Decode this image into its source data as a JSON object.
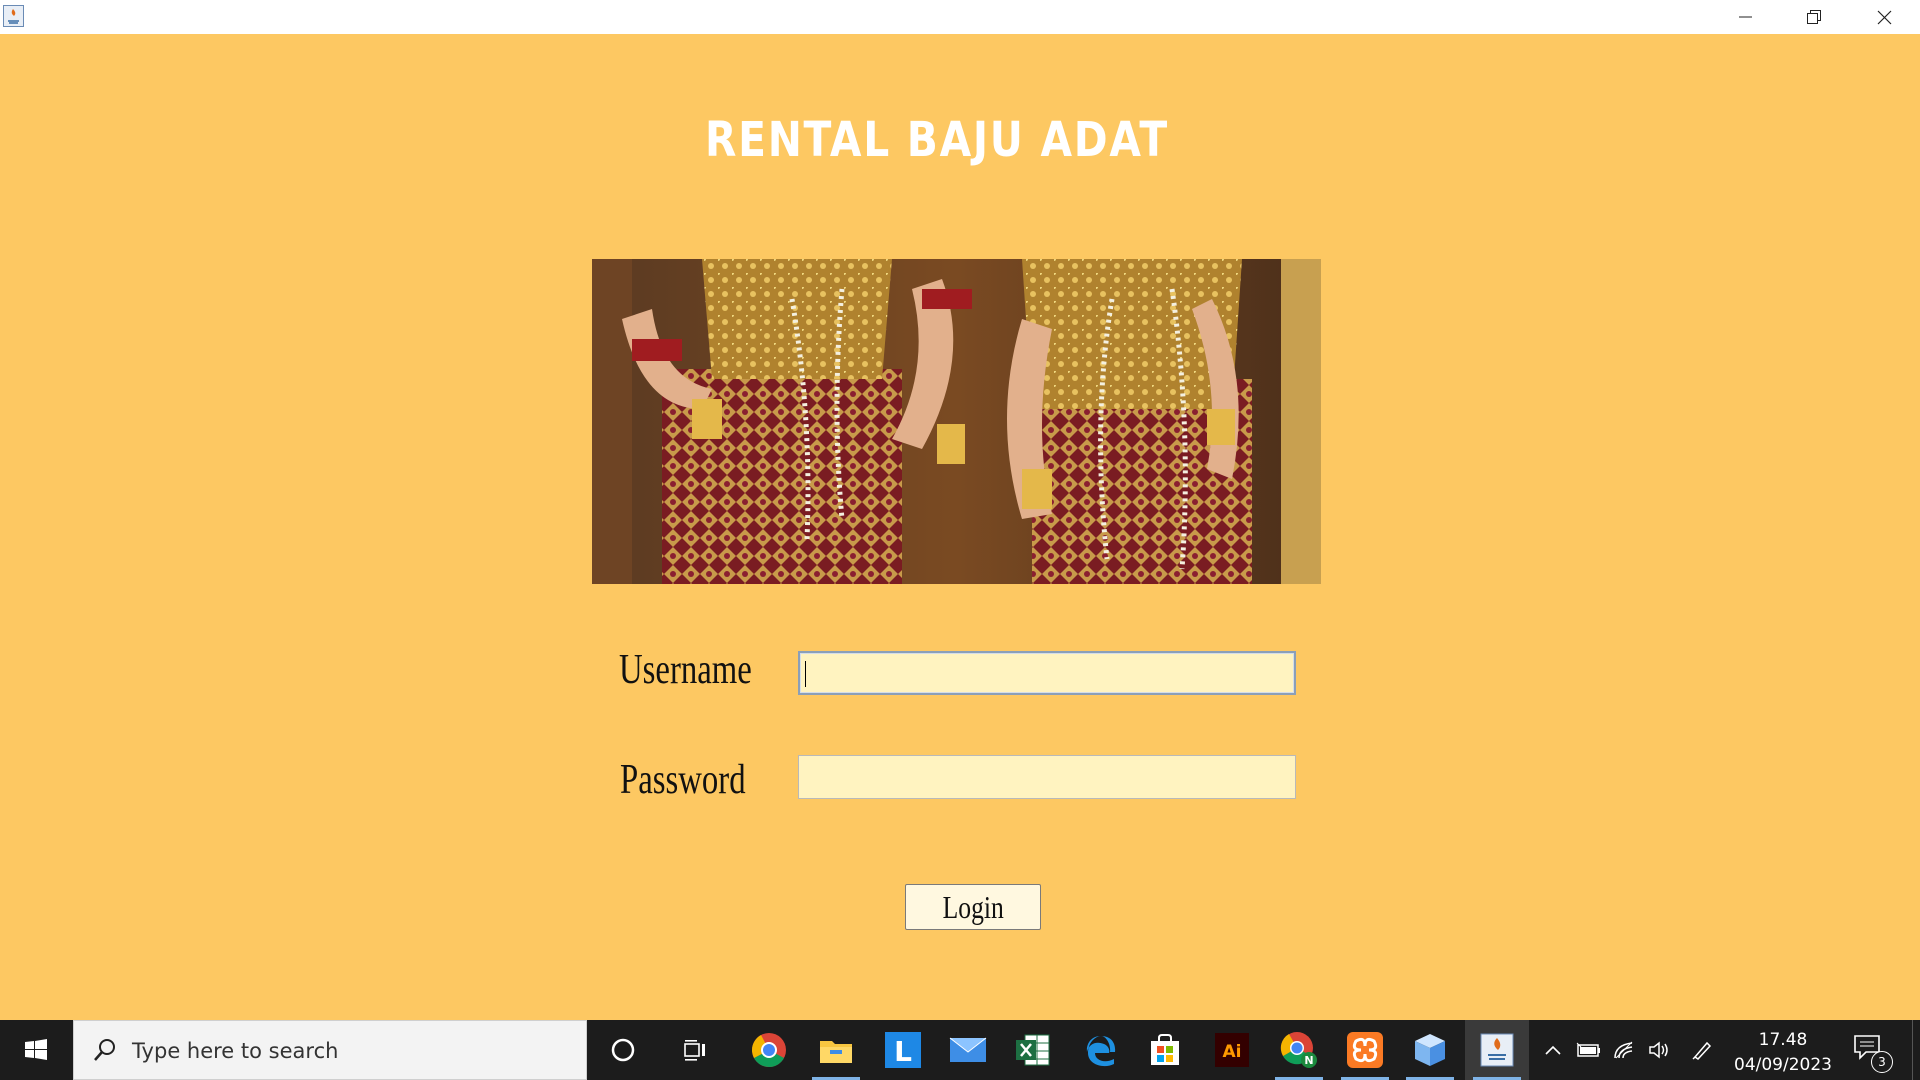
{
  "window": {
    "title": "",
    "controls": {
      "minimize": "minimize-icon",
      "restore": "restore-icon",
      "close": "close-icon"
    }
  },
  "app": {
    "title": "RENTAL BAJU ADAT",
    "banner_image": "traditional-costume-photo",
    "username_label": "Username",
    "username_value": "",
    "password_label": "Password",
    "password_value": "",
    "login_label": "Login",
    "colors": {
      "background": "#fdc862",
      "field": "#fff3c0",
      "title": "#ffffff"
    }
  },
  "taskbar": {
    "search_placeholder": "Type here to search",
    "apps": [
      "cortana",
      "task-view",
      "chrome",
      "file-explorer",
      "l-app",
      "mail",
      "excel",
      "edge",
      "store",
      "illustrator",
      "chrome-profile",
      "xampp",
      "3d-box",
      "java"
    ],
    "illustrator_label": "Ai",
    "l_app_label": "L",
    "chrome_profile_badge": "N",
    "time": "17.48",
    "date": "04/09/2023",
    "notification_count": "3"
  }
}
